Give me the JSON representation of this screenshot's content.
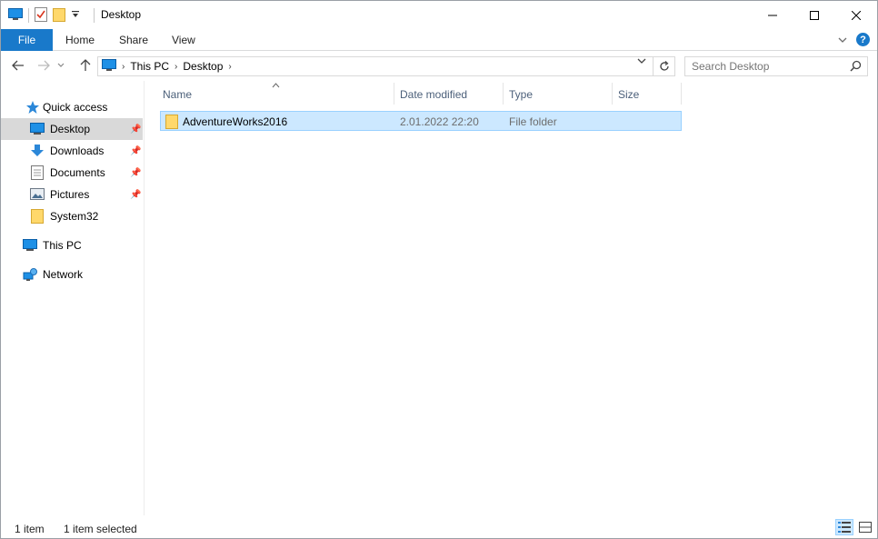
{
  "window": {
    "title": "Desktop"
  },
  "titlebar": {
    "minimize_icon": "minimize-icon",
    "maximize_icon": "maximize-icon",
    "close_icon": "close-icon"
  },
  "ribbon": {
    "tabs": [
      {
        "label": "File"
      },
      {
        "label": "Home"
      },
      {
        "label": "Share"
      },
      {
        "label": "View"
      }
    ],
    "accent_color": "#1979ca"
  },
  "address": {
    "crumbs": [
      "This PC",
      "Desktop"
    ],
    "search_placeholder": "Search Desktop"
  },
  "sidebar": {
    "items": [
      {
        "label": "Quick access",
        "icon": "star-icon"
      },
      {
        "label": "Desktop",
        "icon": "desktop-icon",
        "pinned": true
      },
      {
        "label": "Downloads",
        "icon": "download-arrow-icon",
        "pinned": true
      },
      {
        "label": "Documents",
        "icon": "document-icon",
        "pinned": true
      },
      {
        "label": "Pictures",
        "icon": "pictures-icon",
        "pinned": true
      },
      {
        "label": "System32",
        "icon": "folder-icon"
      },
      {
        "label": "This PC",
        "icon": "computer-icon"
      },
      {
        "label": "Network",
        "icon": "network-icon"
      }
    ]
  },
  "columns": {
    "name": "Name",
    "date": "Date modified",
    "type": "Type",
    "size": "Size"
  },
  "files": [
    {
      "name": "AdventureWorks2016",
      "date": "2.01.2022 22:20",
      "type": "File folder",
      "size": ""
    }
  ],
  "status": {
    "count": "1 item",
    "selected": "1 item selected"
  }
}
